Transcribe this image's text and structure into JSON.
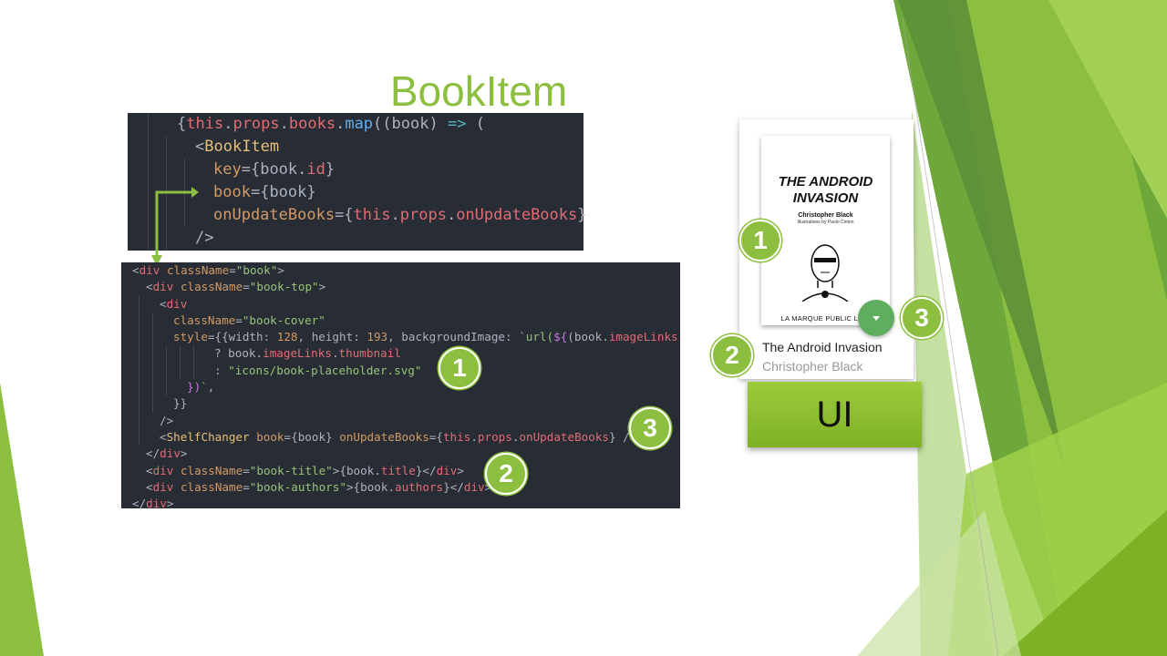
{
  "slide": {
    "title": "BookItem"
  },
  "code_top": [
    {
      "indent": 2,
      "tokens": [
        [
          "pun",
          "{"
        ],
        [
          "this",
          "this"
        ],
        [
          "pun",
          "."
        ],
        [
          "prop",
          "props"
        ],
        [
          "pun",
          "."
        ],
        [
          "prop",
          "books"
        ],
        [
          "pun",
          "."
        ],
        [
          "fn",
          "map"
        ],
        [
          "pun",
          "(("
        ],
        [
          "var",
          "book"
        ],
        [
          "pun",
          ") "
        ],
        [
          "op",
          "=>"
        ],
        [
          "pun",
          " ("
        ]
      ]
    },
    {
      "indent": 3,
      "tokens": [
        [
          "pun",
          "<"
        ],
        [
          "comp",
          "BookItem"
        ]
      ]
    },
    {
      "indent": 4,
      "tokens": [
        [
          "attr",
          "key"
        ],
        [
          "pun",
          "={"
        ],
        [
          "var",
          "book"
        ],
        [
          "pun",
          "."
        ],
        [
          "prop",
          "id"
        ],
        [
          "pun",
          "}"
        ]
      ]
    },
    {
      "indent": 4,
      "tokens": [
        [
          "attr",
          "book"
        ],
        [
          "pun",
          "={"
        ],
        [
          "var",
          "book"
        ],
        [
          "pun",
          "}"
        ]
      ]
    },
    {
      "indent": 4,
      "tokens": [
        [
          "attr",
          "onUpdateBooks"
        ],
        [
          "pun",
          "={"
        ],
        [
          "this",
          "this"
        ],
        [
          "pun",
          "."
        ],
        [
          "prop",
          "props"
        ],
        [
          "pun",
          "."
        ],
        [
          "prop",
          "onUpdateBooks"
        ],
        [
          "pun",
          "}"
        ]
      ]
    },
    {
      "indent": 3,
      "tokens": [
        [
          "pun",
          "/>"
        ]
      ]
    }
  ],
  "code_bottom": [
    {
      "indent": 0,
      "tokens": [
        [
          "pun",
          "<"
        ],
        [
          "tag",
          "div"
        ],
        [
          "pun",
          " "
        ],
        [
          "attr",
          "className"
        ],
        [
          "pun",
          "="
        ],
        [
          "str",
          "\"book\""
        ],
        [
          "pun",
          ">"
        ]
      ]
    },
    {
      "indent": 1,
      "tokens": [
        [
          "pun",
          "<"
        ],
        [
          "tag",
          "div"
        ],
        [
          "pun",
          " "
        ],
        [
          "attr",
          "className"
        ],
        [
          "pun",
          "="
        ],
        [
          "str",
          "\"book-top\""
        ],
        [
          "pun",
          ">"
        ]
      ]
    },
    {
      "indent": 2,
      "tokens": [
        [
          "pun",
          "<"
        ],
        [
          "tag",
          "div"
        ]
      ]
    },
    {
      "indent": 3,
      "tokens": [
        [
          "attr",
          "className"
        ],
        [
          "pun",
          "="
        ],
        [
          "str",
          "\"book-cover\""
        ]
      ]
    },
    {
      "indent": 3,
      "tokens": [
        [
          "attr",
          "style"
        ],
        [
          "pun",
          "={{"
        ],
        [
          "var",
          "width"
        ],
        [
          "pun",
          ": "
        ],
        [
          "attr",
          "128"
        ],
        [
          "pun",
          ", "
        ],
        [
          "var",
          "height"
        ],
        [
          "pun",
          ": "
        ],
        [
          "attr",
          "193"
        ],
        [
          "pun",
          ", "
        ],
        [
          "var",
          "backgroundImage"
        ],
        [
          "pun",
          ": "
        ],
        [
          "str",
          "`url("
        ],
        [
          "kw",
          "${"
        ],
        [
          "pun",
          "("
        ],
        [
          "var",
          "book"
        ],
        [
          "pun",
          "."
        ],
        [
          "prop",
          "imageLinks"
        ]
      ]
    },
    {
      "indent": 6,
      "tokens": [
        [
          "pun",
          "? "
        ],
        [
          "var",
          "book"
        ],
        [
          "pun",
          "."
        ],
        [
          "prop",
          "imageLinks"
        ],
        [
          "pun",
          "."
        ],
        [
          "prop",
          "thumbnail"
        ]
      ]
    },
    {
      "indent": 6,
      "tokens": [
        [
          "pun",
          ": "
        ],
        [
          "str",
          "\"icons/book-placeholder.svg\""
        ]
      ]
    },
    {
      "indent": 4,
      "tokens": [
        [
          "kw",
          "})"
        ],
        [
          "str",
          "`"
        ],
        [
          "pun",
          ","
        ]
      ]
    },
    {
      "indent": 3,
      "tokens": [
        [
          "pun",
          "}}"
        ]
      ]
    },
    {
      "indent": 2,
      "tokens": [
        [
          "pun",
          "/>"
        ]
      ]
    },
    {
      "indent": 2,
      "tokens": [
        [
          "pun",
          "<"
        ],
        [
          "comp",
          "ShelfChanger"
        ],
        [
          "pun",
          " "
        ],
        [
          "attr",
          "book"
        ],
        [
          "pun",
          "={"
        ],
        [
          "var",
          "book"
        ],
        [
          "pun",
          "} "
        ],
        [
          "attr",
          "onUpdateBooks"
        ],
        [
          "pun",
          "={"
        ],
        [
          "this",
          "this"
        ],
        [
          "pun",
          "."
        ],
        [
          "prop",
          "props"
        ],
        [
          "pun",
          "."
        ],
        [
          "prop",
          "onUpdateBooks"
        ],
        [
          "pun",
          "} />"
        ]
      ]
    },
    {
      "indent": 1,
      "tokens": [
        [
          "pun",
          "</"
        ],
        [
          "tag",
          "div"
        ],
        [
          "pun",
          ">"
        ]
      ]
    },
    {
      "indent": 1,
      "tokens": [
        [
          "pun",
          "<"
        ],
        [
          "tag",
          "div"
        ],
        [
          "pun",
          " "
        ],
        [
          "attr",
          "className"
        ],
        [
          "pun",
          "="
        ],
        [
          "str",
          "\"book-title\""
        ],
        [
          "pun",
          ">{"
        ],
        [
          "var",
          "book"
        ],
        [
          "pun",
          "."
        ],
        [
          "prop",
          "title"
        ],
        [
          "pun",
          "}</"
        ],
        [
          "tag",
          "div"
        ],
        [
          "pun",
          ">"
        ]
      ]
    },
    {
      "indent": 1,
      "tokens": [
        [
          "pun",
          "<"
        ],
        [
          "tag",
          "div"
        ],
        [
          "pun",
          " "
        ],
        [
          "attr",
          "className"
        ],
        [
          "pun",
          "="
        ],
        [
          "str",
          "\"book-authors\""
        ],
        [
          "pun",
          ">{"
        ],
        [
          "var",
          "book"
        ],
        [
          "pun",
          "."
        ],
        [
          "prop",
          "authors"
        ],
        [
          "pun",
          "}</"
        ],
        [
          "tag",
          "div"
        ],
        [
          "pun",
          ">"
        ]
      ]
    },
    {
      "indent": 0,
      "tokens": [
        [
          "pun",
          "</"
        ],
        [
          "tag",
          "div"
        ],
        [
          "pun",
          ">"
        ]
      ]
    }
  ],
  "badges": {
    "one": "1",
    "two": "2",
    "three": "3"
  },
  "book": {
    "cover_title": "THE ANDROID INVASION",
    "cover_author": "Christopher Black",
    "cover_illustrations": "Illustrations by Paolo Cinton",
    "cover_publisher": "LA MARQUE PUBLIC LIBR",
    "title": "The Android Invasion",
    "authors": "Christopher Black"
  },
  "ui_label": "UI",
  "colors": {
    "accent": "#8cbf3f",
    "code_bg": "#282c34",
    "shelf_changer": "#5fae5f"
  }
}
